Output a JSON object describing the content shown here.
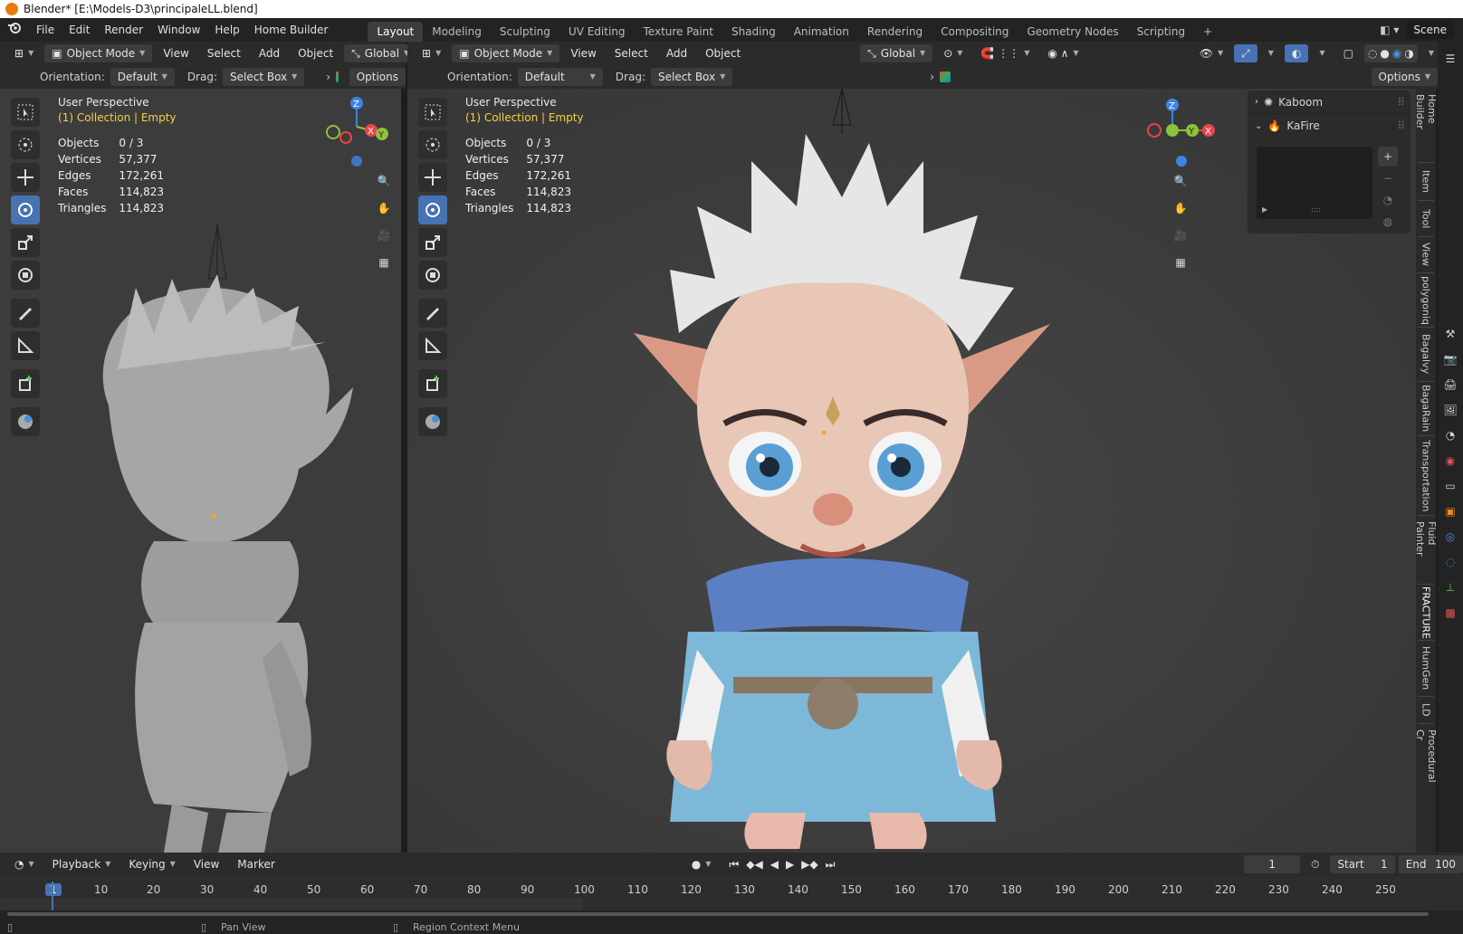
{
  "window_title": "Blender* [E:\\Models-D3\\principaleLL.blend]",
  "menu": [
    "File",
    "Edit",
    "Render",
    "Window",
    "Help",
    "Home Builder"
  ],
  "workspaces": [
    "Layout",
    "Modeling",
    "Sculpting",
    "UV Editing",
    "Texture Paint",
    "Shading",
    "Animation",
    "Rendering",
    "Compositing",
    "Geometry Nodes",
    "Scripting"
  ],
  "active_workspace": "Layout",
  "scene_label": "Scene",
  "left_viewport": {
    "mode": "Object Mode",
    "header_menus": [
      "View",
      "Select",
      "Add",
      "Object"
    ],
    "transform": "Global",
    "orientation_label": "Orientation:",
    "orientation_value": "Default",
    "drag_label": "Drag:",
    "drag_value": "Select Box",
    "options_label": "Options",
    "perspective": "User Perspective",
    "collection": "(1) Collection | Empty",
    "stats": [
      {
        "label": "Objects",
        "value": "0 / 3"
      },
      {
        "label": "Vertices",
        "value": "57,377"
      },
      {
        "label": "Edges",
        "value": "172,261"
      },
      {
        "label": "Faces",
        "value": "114,823"
      },
      {
        "label": "Triangles",
        "value": "114,823"
      }
    ]
  },
  "right_viewport": {
    "mode": "Object Mode",
    "header_menus": [
      "View",
      "Select",
      "Add",
      "Object"
    ],
    "transform": "Global",
    "orientation_label": "Orientation:",
    "orientation_value": "Default",
    "drag_label": "Drag:",
    "drag_value": "Select Box",
    "options_label": "Options",
    "perspective": "User Perspective",
    "collection": "(1) Collection | Empty",
    "stats": [
      {
        "label": "Objects",
        "value": "0 / 3"
      },
      {
        "label": "Vertices",
        "value": "57,377"
      },
      {
        "label": "Edges",
        "value": "172,261"
      },
      {
        "label": "Faces",
        "value": "114,823"
      },
      {
        "label": "Triangles",
        "value": "114,823"
      }
    ]
  },
  "n_panel": {
    "items": [
      "Kaboom",
      "KaFire"
    ]
  },
  "sidebar_tabs": [
    "Home Builder",
    "Item",
    "Tool",
    "View",
    "polygoniq",
    "Bagalvy",
    "BagaRain",
    "Transportation",
    "Fluid Painter",
    "FRACTURE",
    "HumGen",
    "LD",
    "Procedural Cr"
  ],
  "timeline": {
    "menus": [
      "Playback",
      "Keying",
      "View",
      "Marker"
    ],
    "current_frame": "1",
    "start_label": "Start",
    "start_value": "1",
    "end_label": "End",
    "end_value": "100",
    "ticks": [
      "1",
      "10",
      "20",
      "30",
      "40",
      "50",
      "60",
      "70",
      "80",
      "90",
      "100",
      "110",
      "120",
      "130",
      "140",
      "150",
      "160",
      "170",
      "180",
      "190",
      "200",
      "210",
      "220",
      "230",
      "240",
      "250"
    ]
  },
  "status_bar": {
    "pan_view": "Pan View",
    "region_context_menu": "Region Context Menu"
  },
  "colors": {
    "accent_blue": "#4772b3",
    "collection_yellow": "#f5d142",
    "axis_x": "#e8454a",
    "axis_y": "#8bc33a",
    "axis_z": "#3d84e0"
  }
}
